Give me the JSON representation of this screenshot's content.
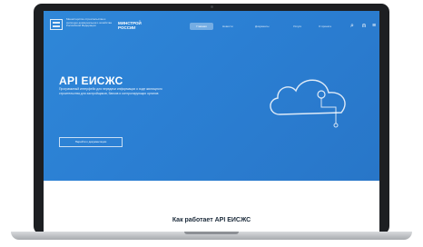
{
  "header": {
    "ministry_text": "Министерство строительства и жилищно-коммунального хозяйства Российской Федерации",
    "brand": "МИНСТРОЙ РОССИИ",
    "nav": [
      {
        "label": "Главная",
        "active": true
      },
      {
        "label": "Новости",
        "active": false
      },
      {
        "label": "Документы",
        "active": false
      },
      {
        "label": "Услуги",
        "active": false
      },
      {
        "label": "О проекте",
        "active": false
      }
    ]
  },
  "hero": {
    "title": "API ЕИСЖС",
    "description": "Программный интерфейс для передачи информации о ходе жилищного строительства для застройщиков, банков и контролирующих органов",
    "button_label": "Перейти к документации"
  },
  "section": {
    "title": "Как работает API ЕИСЖС"
  },
  "icons": [
    "ministry-logo-icon",
    "cloud-network-icon",
    "search-icon",
    "user-icon",
    "menu-icon"
  ],
  "colors": {
    "hero_blue": "#2b7fd3",
    "laptop_frame": "#1d1f22"
  }
}
